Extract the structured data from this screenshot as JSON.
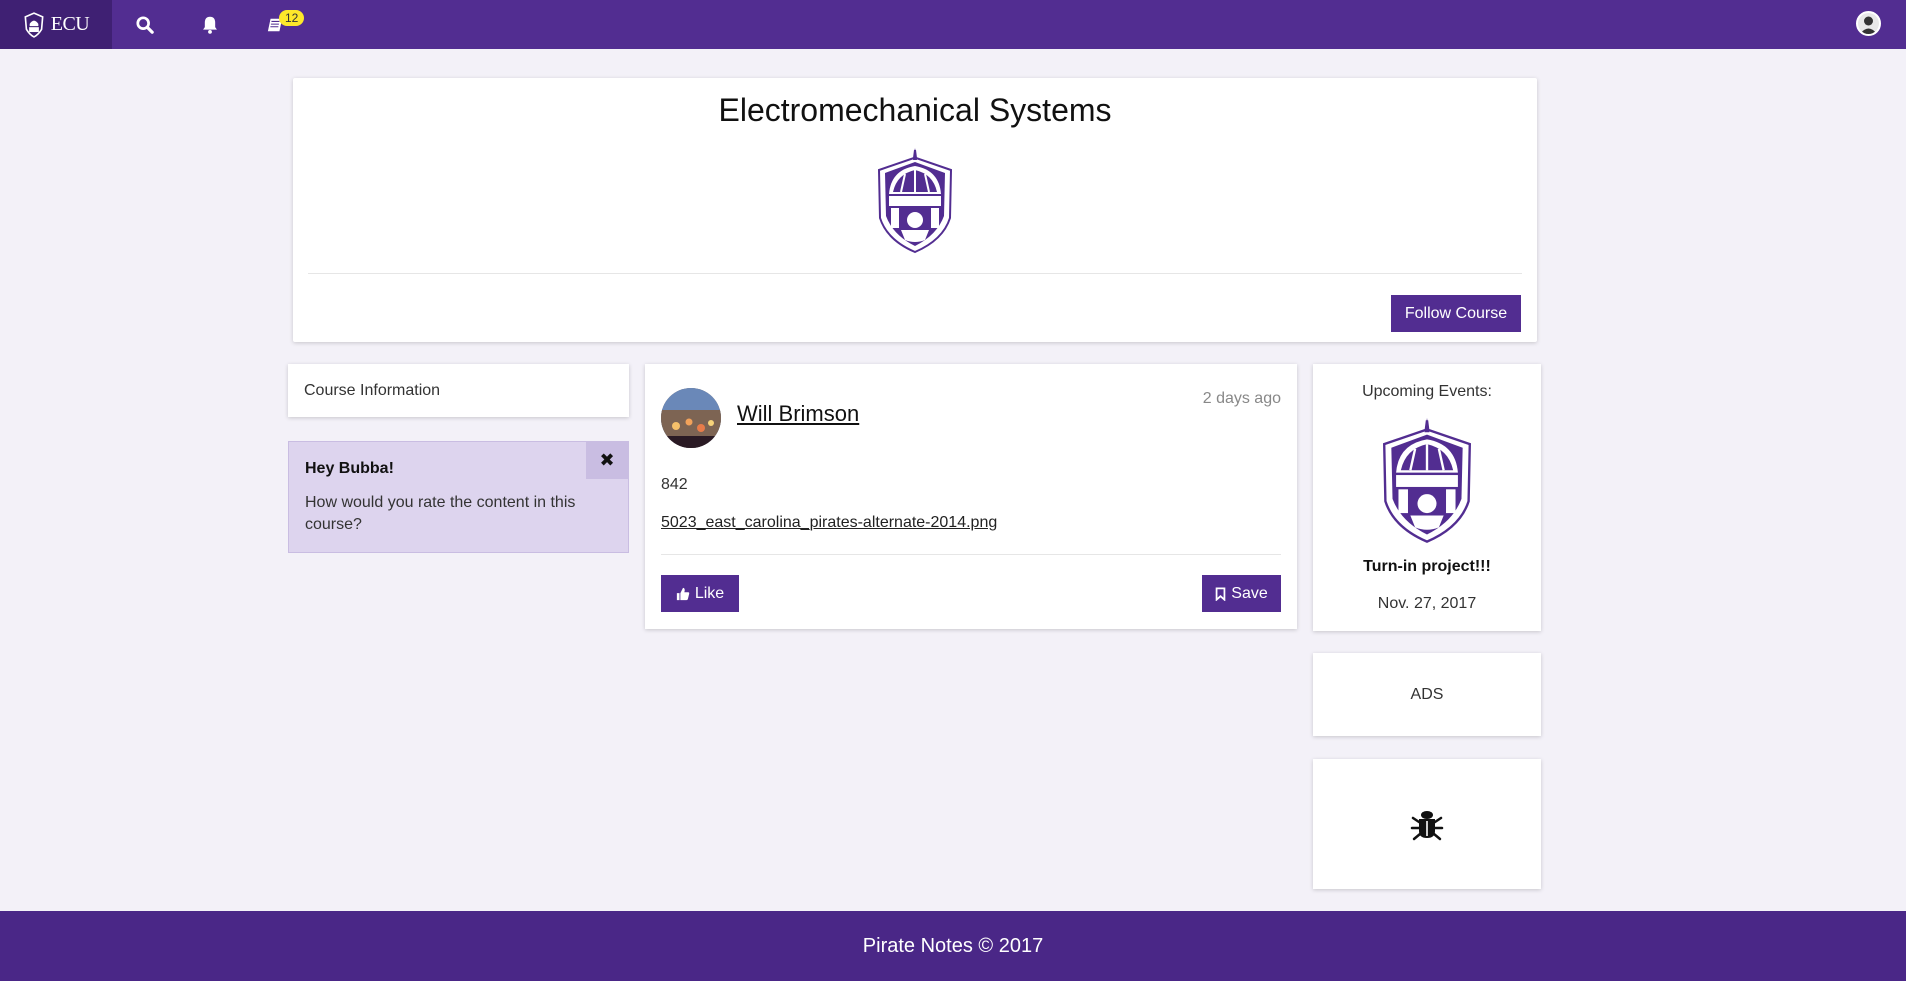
{
  "nav": {
    "brand": "ECU",
    "notes_badge": "12"
  },
  "course": {
    "title": "Electromechanical Systems",
    "follow_label": "Follow Course"
  },
  "sidebar": {
    "course_info_label": "Course Information",
    "alert": {
      "title": "Hey Bubba!",
      "text": "How would you rate the content in this course?",
      "close": "✖"
    }
  },
  "post": {
    "author": "Will Brimson",
    "time": "2 days ago",
    "body": "842",
    "file": "5023_east_carolina_pirates-alternate-2014.png",
    "like_label": "Like",
    "save_label": "Save"
  },
  "events": {
    "title": "Upcoming Events:",
    "name": "Turn-in project!!!",
    "date": "Nov. 27, 2017"
  },
  "ads": {
    "label": "ADS"
  },
  "footer": {
    "text": "Pirate Notes © 2017"
  },
  "colors": {
    "brand_purple": "#522d91",
    "badge_yellow": "#fde82a",
    "alert_bg": "#ddd4ee"
  }
}
